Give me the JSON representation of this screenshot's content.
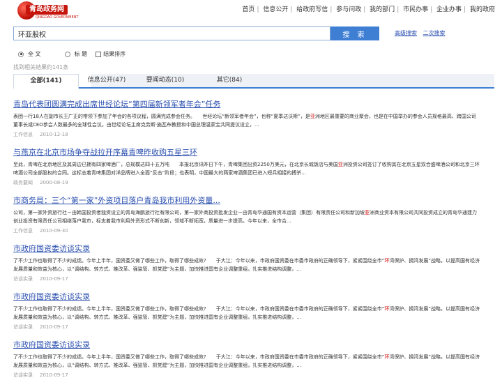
{
  "logo": {
    "text": "青岛政务网",
    "sub": "QINGDAO GOVERNMENT"
  },
  "topnav": [
    "首页",
    "信息公开",
    "给政府写信",
    "参与问政",
    "我的部门",
    "市民办事",
    "企业办事",
    "我的政府"
  ],
  "search": {
    "value": "环亚股权",
    "button": "搜 索"
  },
  "adv": {
    "advanced": "高级搜索",
    "second": "二次搜索"
  },
  "options": {
    "fulltext": "全 文",
    "title": "标 题",
    "sort": "结果排序"
  },
  "count": "找到相关结果约141条",
  "tabs": [
    "全部(141)",
    "信息公开(47)",
    "要闻动态(10)",
    "其它(84)"
  ],
  "results": [
    {
      "title": "青岛代表团圆满完成出席世经论坛“第四届新领军者年会”任务",
      "snippet_pre": "表团一行18人在副市长王广正的带领下参加了年会的各项议程，圆满完成参会任务。　　世经论坛“新领军者年会”，也称“夏季达沃斯”，是",
      "snippet_hl": "亚",
      "snippet_post": "洲地区最重要的商业聚会，也是在中国举办的参会人员规格最高、跨国公司董事长或CEO参会人数最多的全球性会议。由世经论坛主席克劳斯·施瓦布教授和中国总理温家宝共同提议设立，...",
      "source": "工作信息",
      "date": "2010-12-18"
    },
    {
      "title": "与燕京在北京市场争夺战拉开序幕青啤昨收购五星三环",
      "snippet_pre": "至此，青啤在北京地区及其周边已拥有四家啤酒厂，总规模达四十五万吨　　本报北京讯昨日下午，青啤集团出资2250万美元，在北京长城饭店与美国",
      "snippet_hl": "亚",
      "snippet_post": "洲投资公司签订了收购其在北京五星双合盛啤酒公司和北京三环啤酒公司全部股权的合同。这标志着青啤集团对洋品牌进入全面“反击”阶段；也表明，中国最大的两家啤酒集团已进入短兵相接的搏杀...",
      "source": "政务要闻",
      "date": "2000-08-19"
    },
    {
      "title": "市商务局：三个“第一家”外资项目落户青岛我市利用外资量...",
      "snippet_pre": "公司，第一家外资旅行社－由韩国投资者独资设立的青岛海鹏旅行社有限公司，第一家外商投资批发企业－由青岛华通国有资本运营（集团）有限责任公司和新加坡",
      "snippet_hl": "亚",
      "snippet_post": "洲商业资本有限公司共同投资成立的青岛华通建力创业投资有限责任公司相继落户我市，标志着我市利用外资形式不断创新，领域不断拓宽，质量进一步提高。今年以来，全市合...",
      "source": "工作信息",
      "date": "2010-09-30"
    },
    {
      "title": "市政府国资委访谈实录",
      "snippet_pre": "了不少工作也取得了不少的成绩。今年上半年，国资委又做了哪些工作，取得了哪些成效?　　于大江：今年以来，市政府国资委在市委市政府的正确领导下，紧紧围绕全市“",
      "snippet_hl": "环",
      "snippet_post": "湾保护、拥湾发展”战略，以提高国有经济发展质量和效益为核心，以“调结构、转方式、推改革、强监管、抓党建”为主题，加快推进国有企业调整重组，扎实推进结构调整，...",
      "source": "访谈实录",
      "date": "2010-09-17"
    },
    {
      "title": "市政府国资委访谈实录",
      "snippet_pre": "了不少工作也取得了不少的成绩。今年上半年，国资委又做了哪些工作，取得了哪些成效?　　于大江：今年以来，市政府国资委在市委市政府的正确领导下，紧紧围绕全市“",
      "snippet_hl": "环",
      "snippet_post": "湾保护、拥湾发展”战略，以提高国有经济发展质量和效益为核心，以“调结构、转方式、推改革、强监管、抓党建”为主题，加快推进国有企业调整重组，扎实推进结构调整，...",
      "source": "访谈实录",
      "date": "2010-09-17"
    },
    {
      "title": "市政府国资委访谈实录",
      "snippet_pre": "了不少工作也取得了不少的成绩。今年上半年，国资委又做了哪些工作，取得了哪些成效?　　于大江：今年以来，市政府国资委在市委市政府的正确领导下，紧紧围绕全市“",
      "snippet_hl": "环",
      "snippet_post": "湾保护、拥湾发展”战略，以提高国有经济发展质量和效益为核心，以“调结构、转方式、推改革、强监管、抓党建”为主题，加快推进国有企业调整重组，扎实推进结构调整，...",
      "source": "访谈实录",
      "date": "2010-09-17"
    }
  ]
}
